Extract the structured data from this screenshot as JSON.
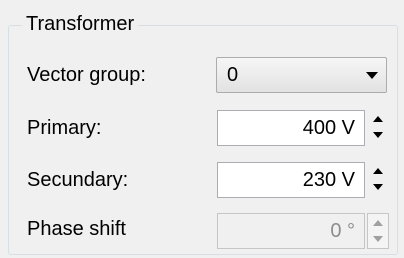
{
  "group": {
    "title": "Transformer"
  },
  "rows": {
    "vector_group": {
      "label": "Vector group:",
      "value": "0"
    },
    "primary": {
      "label": "Primary:",
      "value": "400 V"
    },
    "secundary": {
      "label": "Secundary:",
      "value": "230 V"
    },
    "phase_shift": {
      "label": "Phase shift",
      "value": "0 °",
      "disabled": true
    }
  },
  "icons": {
    "dropdown": "chevron-down-icon",
    "spin_up": "arrow-up-icon",
    "spin_down": "arrow-down-icon"
  },
  "colors": {
    "background": "#f0f0f0",
    "border": "#d5dfe5",
    "disabled_text": "#8d8d8d"
  }
}
